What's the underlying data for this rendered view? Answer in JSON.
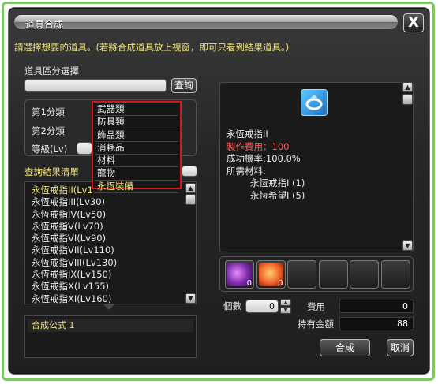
{
  "window": {
    "title": "道具合成",
    "close_label": "X",
    "hint": "請選擇想要的道具。(若將合成道具放上視窗，即可只看到結果道具。)"
  },
  "filter": {
    "section_label": "道具區分選擇",
    "search_value": "",
    "search_button": "查詢",
    "category1_label": "第1分類",
    "category2_label": "第2分類",
    "level_label": "等級(Lv)"
  },
  "dropdown": {
    "options": [
      "武器類",
      "防具類",
      "飾品類",
      "消耗品",
      "材料",
      "寵物",
      "永恆裝備"
    ],
    "selected": "永恆裝備"
  },
  "results": {
    "header": "查詢結果清單",
    "items": [
      "永恆戒指II(Lv1",
      "永恆戒指III(Lv30)",
      "永恆戒指IV(Lv50)",
      "永恆戒指V(Lv70)",
      "永恆戒指VI(Lv90)",
      "永恆戒指VII(Lv110)",
      "永恆戒指VIII(Lv130)",
      "永恆戒指IX(Lv150)",
      "永恆戒指X(Lv155)",
      "永恆戒指XI(Lv160)"
    ]
  },
  "formula": {
    "label": "合成公式 1"
  },
  "detail": {
    "item_name": "永恆戒指II",
    "cost_line": "製作費用：100",
    "rate_line": "成功機率:100.0%",
    "materials_label": "所需材料:",
    "materials": [
      "永恆戒指I (1)",
      "永恆希望I (5)"
    ]
  },
  "slots": [
    {
      "icon": "purple-material-icon",
      "count": "0"
    },
    {
      "icon": "orange-material-icon",
      "count": "0"
    },
    {
      "icon": "",
      "count": ""
    },
    {
      "icon": "",
      "count": ""
    },
    {
      "icon": "",
      "count": ""
    },
    {
      "icon": "",
      "count": ""
    }
  ],
  "bottom": {
    "quantity_label": "個數",
    "quantity_value": "0",
    "fee_label": "費用",
    "fee_value": "0",
    "money_label": "持有金額",
    "money_value": "88",
    "combine_button": "合成",
    "cancel_button": "取消"
  },
  "colors": {
    "accent_yellow": "#f0e27a",
    "cost_red": "#ff5a5a",
    "highlight_red": "#d11919",
    "frame_green": "#7ec86a"
  }
}
